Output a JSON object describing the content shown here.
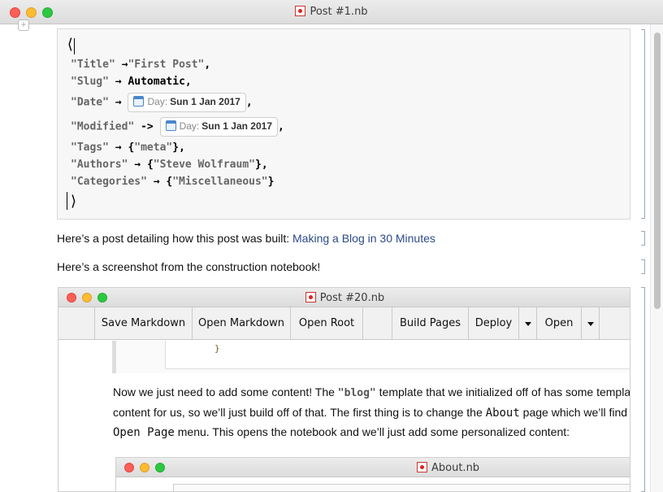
{
  "window": {
    "title": "Post #1.nb"
  },
  "code": {
    "open_brace": "⟨",
    "close_brace": "⟩",
    "lines": {
      "title_key": "\"Title\"",
      "title_arrow": "→",
      "title_val": "\"First Post\"",
      "title_comma": ",",
      "slug_key": "\"Slug\"",
      "slug_arrow": "→",
      "slug_val": "Automatic",
      "slug_comma": ",",
      "date_key": "\"Date\"",
      "date_arrow": "→",
      "date_comma": ",",
      "modified_key": "\"Modified\"",
      "modified_arrow": "->",
      "modified_comma": ",",
      "tags_key": "\"Tags\"",
      "tags_arrow": "→",
      "tags_val_open": "{",
      "tags_val": "\"meta\"",
      "tags_val_close": "}",
      "tags_comma": ",",
      "authors_key": "\"Authors\"",
      "authors_arrow": "→",
      "authors_val_open": "{",
      "authors_val": "\"Steve Wolfraum\"",
      "authors_val_close": "}",
      "authors_comma": ",",
      "categories_key": "\"Categories\"",
      "categories_arrow": "→",
      "categories_val_open": "{",
      "categories_val": "\"Miscellaneous\"",
      "categories_val_close": "}"
    },
    "date_box": {
      "label": "Day:",
      "value": "Sun 1 Jan 2017"
    },
    "modified_box": {
      "label": "Day:",
      "value": "Sun 1 Jan 2017"
    }
  },
  "text1": {
    "prefix": "Here’s a post detailing how this post was built: ",
    "link": "Making a Blog in 30 Minutes"
  },
  "text2": "Here’s a screenshot from the construction notebook!",
  "inner_window": {
    "title": "Post #20.nb",
    "toolbar": {
      "save_markdown": "Save Markdown",
      "open_markdown": "Open Markdown",
      "open_root": "Open Root",
      "build_pages": "Build Pages",
      "deploy": "Deploy",
      "open": "Open"
    },
    "code_brace": "}",
    "para": {
      "l1_a": "Now we just need to add some content! The ",
      "l1_code": "\"blog\"",
      "l1_b": " template that we initialized off of has some template",
      "l2_a": "content for us, so we’ll just build off of that. The first thing is to change the ",
      "l2_code": "About",
      "l2_b": " page which we’ll find",
      "l3_code": "Open Page",
      "l3_b": " menu. This opens the notebook and we’ll just add some personalized content:"
    },
    "about_window": {
      "title": "About.nb"
    }
  }
}
